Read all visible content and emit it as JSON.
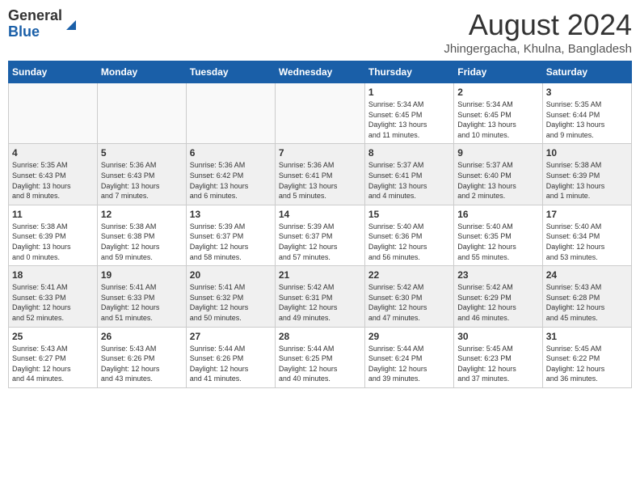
{
  "header": {
    "logo": {
      "line1": "General",
      "line2": "Blue"
    },
    "title": "August 2024",
    "location": "Jhingergacha, Khulna, Bangladesh"
  },
  "days_of_week": [
    "Sunday",
    "Monday",
    "Tuesday",
    "Wednesday",
    "Thursday",
    "Friday",
    "Saturday"
  ],
  "weeks": [
    [
      {
        "day": "",
        "info": ""
      },
      {
        "day": "",
        "info": ""
      },
      {
        "day": "",
        "info": ""
      },
      {
        "day": "",
        "info": ""
      },
      {
        "day": "1",
        "info": "Sunrise: 5:34 AM\nSunset: 6:45 PM\nDaylight: 13 hours\nand 11 minutes."
      },
      {
        "day": "2",
        "info": "Sunrise: 5:34 AM\nSunset: 6:45 PM\nDaylight: 13 hours\nand 10 minutes."
      },
      {
        "day": "3",
        "info": "Sunrise: 5:35 AM\nSunset: 6:44 PM\nDaylight: 13 hours\nand 9 minutes."
      }
    ],
    [
      {
        "day": "4",
        "info": "Sunrise: 5:35 AM\nSunset: 6:43 PM\nDaylight: 13 hours\nand 8 minutes."
      },
      {
        "day": "5",
        "info": "Sunrise: 5:36 AM\nSunset: 6:43 PM\nDaylight: 13 hours\nand 7 minutes."
      },
      {
        "day": "6",
        "info": "Sunrise: 5:36 AM\nSunset: 6:42 PM\nDaylight: 13 hours\nand 6 minutes."
      },
      {
        "day": "7",
        "info": "Sunrise: 5:36 AM\nSunset: 6:41 PM\nDaylight: 13 hours\nand 5 minutes."
      },
      {
        "day": "8",
        "info": "Sunrise: 5:37 AM\nSunset: 6:41 PM\nDaylight: 13 hours\nand 4 minutes."
      },
      {
        "day": "9",
        "info": "Sunrise: 5:37 AM\nSunset: 6:40 PM\nDaylight: 13 hours\nand 2 minutes."
      },
      {
        "day": "10",
        "info": "Sunrise: 5:38 AM\nSunset: 6:39 PM\nDaylight: 13 hours\nand 1 minute."
      }
    ],
    [
      {
        "day": "11",
        "info": "Sunrise: 5:38 AM\nSunset: 6:39 PM\nDaylight: 13 hours\nand 0 minutes."
      },
      {
        "day": "12",
        "info": "Sunrise: 5:38 AM\nSunset: 6:38 PM\nDaylight: 12 hours\nand 59 minutes."
      },
      {
        "day": "13",
        "info": "Sunrise: 5:39 AM\nSunset: 6:37 PM\nDaylight: 12 hours\nand 58 minutes."
      },
      {
        "day": "14",
        "info": "Sunrise: 5:39 AM\nSunset: 6:37 PM\nDaylight: 12 hours\nand 57 minutes."
      },
      {
        "day": "15",
        "info": "Sunrise: 5:40 AM\nSunset: 6:36 PM\nDaylight: 12 hours\nand 56 minutes."
      },
      {
        "day": "16",
        "info": "Sunrise: 5:40 AM\nSunset: 6:35 PM\nDaylight: 12 hours\nand 55 minutes."
      },
      {
        "day": "17",
        "info": "Sunrise: 5:40 AM\nSunset: 6:34 PM\nDaylight: 12 hours\nand 53 minutes."
      }
    ],
    [
      {
        "day": "18",
        "info": "Sunrise: 5:41 AM\nSunset: 6:33 PM\nDaylight: 12 hours\nand 52 minutes."
      },
      {
        "day": "19",
        "info": "Sunrise: 5:41 AM\nSunset: 6:33 PM\nDaylight: 12 hours\nand 51 minutes."
      },
      {
        "day": "20",
        "info": "Sunrise: 5:41 AM\nSunset: 6:32 PM\nDaylight: 12 hours\nand 50 minutes."
      },
      {
        "day": "21",
        "info": "Sunrise: 5:42 AM\nSunset: 6:31 PM\nDaylight: 12 hours\nand 49 minutes."
      },
      {
        "day": "22",
        "info": "Sunrise: 5:42 AM\nSunset: 6:30 PM\nDaylight: 12 hours\nand 47 minutes."
      },
      {
        "day": "23",
        "info": "Sunrise: 5:42 AM\nSunset: 6:29 PM\nDaylight: 12 hours\nand 46 minutes."
      },
      {
        "day": "24",
        "info": "Sunrise: 5:43 AM\nSunset: 6:28 PM\nDaylight: 12 hours\nand 45 minutes."
      }
    ],
    [
      {
        "day": "25",
        "info": "Sunrise: 5:43 AM\nSunset: 6:27 PM\nDaylight: 12 hours\nand 44 minutes."
      },
      {
        "day": "26",
        "info": "Sunrise: 5:43 AM\nSunset: 6:26 PM\nDaylight: 12 hours\nand 43 minutes."
      },
      {
        "day": "27",
        "info": "Sunrise: 5:44 AM\nSunset: 6:26 PM\nDaylight: 12 hours\nand 41 minutes."
      },
      {
        "day": "28",
        "info": "Sunrise: 5:44 AM\nSunset: 6:25 PM\nDaylight: 12 hours\nand 40 minutes."
      },
      {
        "day": "29",
        "info": "Sunrise: 5:44 AM\nSunset: 6:24 PM\nDaylight: 12 hours\nand 39 minutes."
      },
      {
        "day": "30",
        "info": "Sunrise: 5:45 AM\nSunset: 6:23 PM\nDaylight: 12 hours\nand 37 minutes."
      },
      {
        "day": "31",
        "info": "Sunrise: 5:45 AM\nSunset: 6:22 PM\nDaylight: 12 hours\nand 36 minutes."
      }
    ]
  ]
}
